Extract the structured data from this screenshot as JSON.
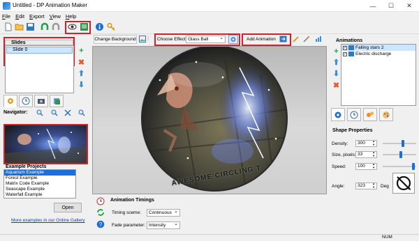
{
  "window": {
    "title": "Untitled - DP Animation Maker"
  },
  "menu": [
    "File",
    "Edit",
    "Export",
    "View",
    "Help"
  ],
  "toolbar_icons": [
    "new-icon",
    "open-icon",
    "save-icon",
    "undo-icon",
    "redo-icon",
    "preview-icon",
    "export-icon",
    "info-icon",
    "key-icon"
  ],
  "slides": {
    "header": "Slides",
    "items": [
      "Slide 0"
    ]
  },
  "navigator": {
    "label": "Navigator:"
  },
  "projects": {
    "label": "Example Projects",
    "items": [
      "Aquarium Example",
      "Forest Example",
      "Matrix Code Example",
      "Seascape Example",
      "Waterfall Example"
    ],
    "selected_index": 0,
    "open_label": "Open",
    "gallery_link": "More examples in our Online Gallery"
  },
  "effect_bar": {
    "change_background": "Change Background",
    "choose_effect_label": "Choose Effect:",
    "effect_value": "Glass Ball",
    "add_animation": "Add Animation"
  },
  "stage": {
    "overlay_text": "AWESOME CIRCLING T"
  },
  "timings": {
    "title": "Animation Timings",
    "timing_scene_label": "Timing sceme:",
    "timing_scene_value": "Continuous",
    "fade_label": "Fade parameter:",
    "fade_value": "Intensity"
  },
  "animations": {
    "label": "Animations",
    "items": [
      {
        "name": "Falling stars 2",
        "checked": true,
        "selected": true
      },
      {
        "name": "Electric discharge",
        "checked": true,
        "selected": false
      }
    ]
  },
  "shape_properties": {
    "title": "Shape Properties",
    "density": {
      "label": "Density:",
      "value": "300",
      "level": 0.62
    },
    "size": {
      "label": "Size, pixels:",
      "value": "33",
      "level": 0.55
    },
    "speed": {
      "label": "Speed:",
      "value": "100",
      "level": 0.95
    },
    "angle": {
      "label": "Angle:",
      "value": "323",
      "unit": "Deg"
    }
  },
  "status": {
    "num": "NUM"
  },
  "colors": {
    "highlight": "#d62027",
    "selection": "#cde6ff",
    "accent": "#1b6fd6"
  }
}
